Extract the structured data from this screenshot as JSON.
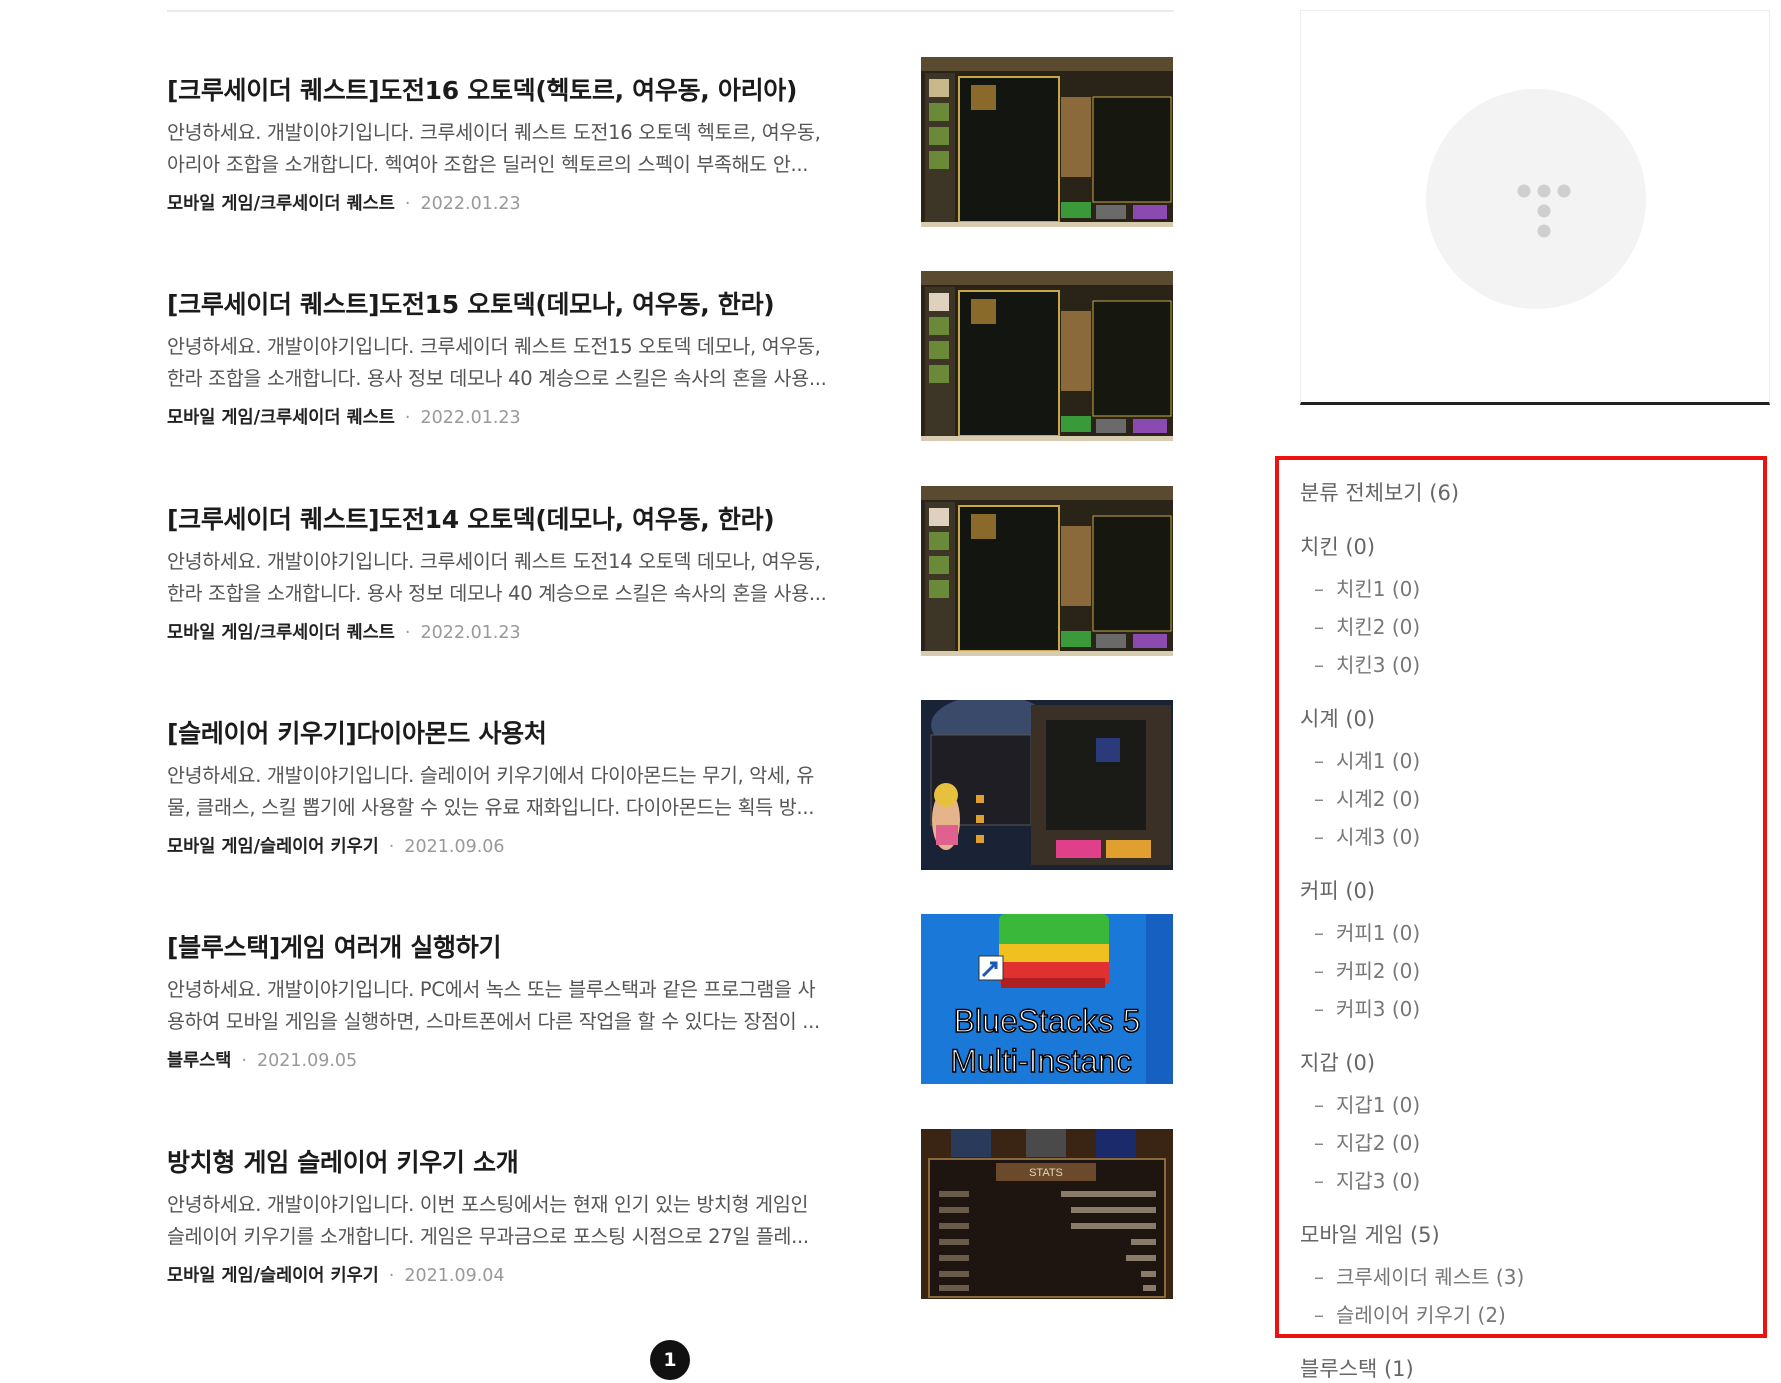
{
  "posts": [
    {
      "title": "[크루세이더 퀘스트]도전16 오토덱(헥토르, 여우동, 아리아)",
      "excerpt_line1": "안녕하세요. 개발이야기입니다. 크루세이더 퀘스트 도전16 오토덱 헥토르, 여우동,",
      "excerpt_line2": "아리아 조합을 소개합니다. 헥여아 조합은 딜러인 헥토르의 스펙이 부족해도 안...",
      "category": "모바일 게임/크루세이더 퀘스트",
      "sep": "·",
      "date": "2022.01.23"
    },
    {
      "title": "[크루세이더 퀘스트]도전15 오토덱(데모나, 여우동, 한라)",
      "excerpt_line1": "안녕하세요. 개발이야기입니다. 크루세이더 퀘스트 도전15 오토덱 데모나, 여우동,",
      "excerpt_line2": "한라 조합을 소개합니다. 용사 정보 데모나 40 계승으로 스킬은 속사의 혼을 사용...",
      "category": "모바일 게임/크루세이더 퀘스트",
      "sep": "·",
      "date": "2022.01.23"
    },
    {
      "title": "[크루세이더 퀘스트]도전14 오토덱(데모나, 여우동, 한라)",
      "excerpt_line1": "안녕하세요. 개발이야기입니다. 크루세이더 퀘스트 도전14 오토덱 데모나, 여우동,",
      "excerpt_line2": "한라 조합을 소개합니다. 용사 정보 데모나 40 계승으로 스킬은 속사의 혼을 사용...",
      "category": "모바일 게임/크루세이더 퀘스트",
      "sep": "·",
      "date": "2022.01.23"
    },
    {
      "title": "[슬레이어 키우기]다이아몬드 사용처",
      "excerpt_line1": "안녕하세요. 개발이야기입니다. 슬레이어 키우기에서 다이아몬드는 무기, 악세, 유",
      "excerpt_line2": "물, 클래스, 스킬 뽑기에 사용할 수 있는 유료 재화입니다. 다이아몬드는 획득 방...",
      "category": "모바일 게임/슬레이어 키우기",
      "sep": "·",
      "date": "2021.09.06"
    },
    {
      "title": "[블루스택]게임 여러개 실행하기",
      "excerpt_line1": "안녕하세요. 개발이야기입니다. PC에서 녹스 또는 블루스택과 같은 프로그램을 사",
      "excerpt_line2": "용하여 모바일 게임을 실행하면, 스마트폰에서 다른 작업을 할 수 있다는 장점이 ...",
      "category": "블루스택",
      "sep": "·",
      "date": "2021.09.05",
      "thumb_text1": "BlueStacks 5",
      "thumb_text2": "Multi-Instanc"
    },
    {
      "title": "방치형 게임 슬레이어 키우기 소개",
      "excerpt_line1": "안녕하세요. 개발이야기입니다. 이번 포스팅에서는 현재 인기 있는 방치형 게임인",
      "excerpt_line2": "슬레이어 키우기를 소개합니다. 게임은 무과금으로 포스팅 시점으로 27일 플레...",
      "category": "모바일 게임/슬레이어 키우기",
      "sep": "·",
      "date": "2021.09.04",
      "thumb_header": "STATS"
    }
  ],
  "pagination": {
    "current": "1"
  },
  "categories": [
    {
      "label": "분류 전체보기 (6)",
      "level": 0
    },
    {
      "label": "치킨 (0)",
      "level": 1
    },
    {
      "label": "치킨1 (0)",
      "level": 2
    },
    {
      "label": "치킨2 (0)",
      "level": 2
    },
    {
      "label": "치킨3 (0)",
      "level": 2
    },
    {
      "label": "시계 (0)",
      "level": 1
    },
    {
      "label": "시계1 (0)",
      "level": 2
    },
    {
      "label": "시계2 (0)",
      "level": 2
    },
    {
      "label": "시계3 (0)",
      "level": 2
    },
    {
      "label": "커피 (0)",
      "level": 1
    },
    {
      "label": "커피1 (0)",
      "level": 2
    },
    {
      "label": "커피2 (0)",
      "level": 2
    },
    {
      "label": "커피3 (0)",
      "level": 2
    },
    {
      "label": "지갑 (0)",
      "level": 1
    },
    {
      "label": "지갑1 (0)",
      "level": 2
    },
    {
      "label": "지갑2 (0)",
      "level": 2
    },
    {
      "label": "지갑3 (0)",
      "level": 2
    },
    {
      "label": "모바일 게임 (5)",
      "level": 1
    },
    {
      "label": "크루세이더 퀘스트 (3)",
      "level": 2
    },
    {
      "label": "슬레이어 키우기 (2)",
      "level": 2
    },
    {
      "label": "블루스택 (1)",
      "level": 1
    }
  ],
  "category_dash": "–",
  "highlight_color": "#ee1111"
}
